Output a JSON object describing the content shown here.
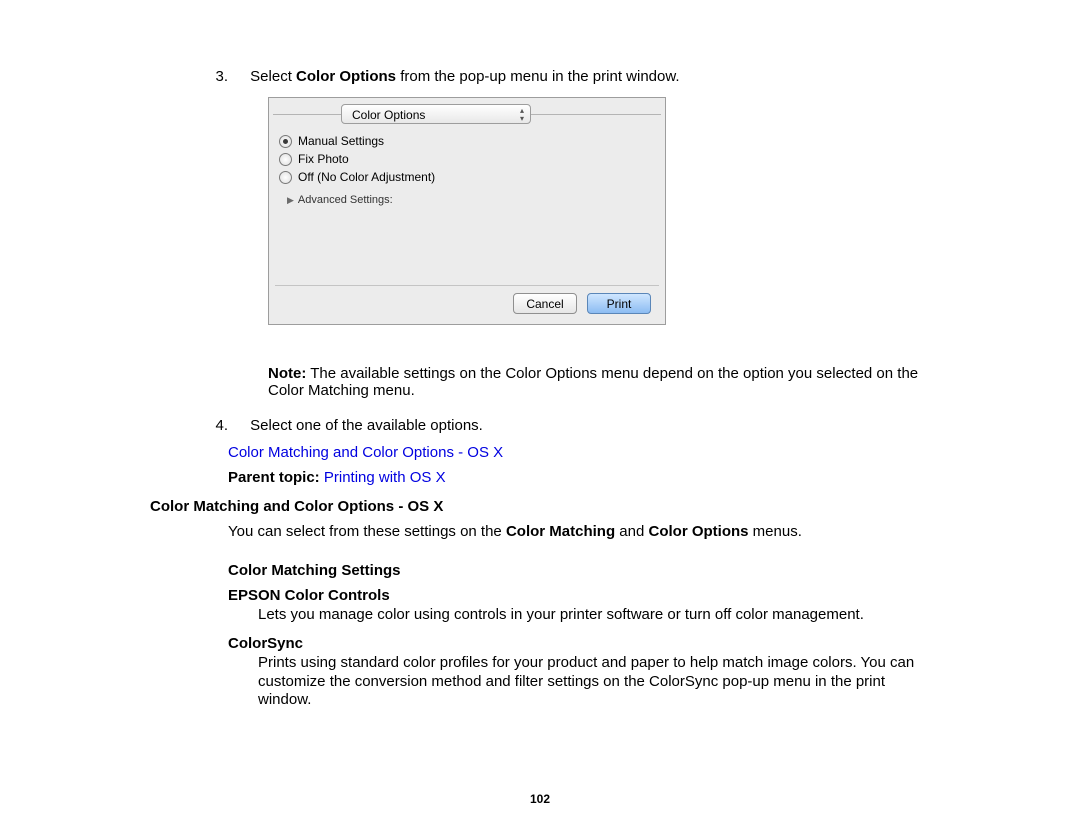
{
  "step3": {
    "num": "3.",
    "pre": "Select ",
    "bold": "Color Options",
    "post": " from the pop-up menu in the print window."
  },
  "dialog": {
    "select_label": "Color Options",
    "radios": {
      "r0": "Manual Settings",
      "r1": "Fix Photo",
      "r2": "Off (No Color Adjustment)"
    },
    "advanced": "Advanced Settings:",
    "cancel": "Cancel",
    "print": "Print"
  },
  "note": {
    "label": "Note:",
    "text": " The available settings on the Color Options menu depend on the option you selected on the Color Matching menu."
  },
  "step4": {
    "num": "4.",
    "text": "Select one of the available options."
  },
  "link1": "Color Matching and Color Options - OS X",
  "parent": {
    "label": "Parent topic: ",
    "link": "Printing with OS X"
  },
  "subsection_heading": "Color Matching and Color Options - OS X",
  "subsection_para_pre": "You can select from these settings on the ",
  "subsection_para_b1": "Color Matching",
  "subsection_para_mid": " and ",
  "subsection_para_b2": "Color Options",
  "subsection_para_post": " menus.",
  "cm_settings_heading": "Color Matching Settings",
  "epson_heading": "EPSON Color Controls",
  "epson_text": "Lets you manage color using controls in your printer software or turn off color management.",
  "colorsync_heading": "ColorSync",
  "colorsync_text": "Prints using standard color profiles for your product and paper to help match image colors. You can customize the conversion method and filter settings on the ColorSync pop-up menu in the print window.",
  "page_number": "102"
}
